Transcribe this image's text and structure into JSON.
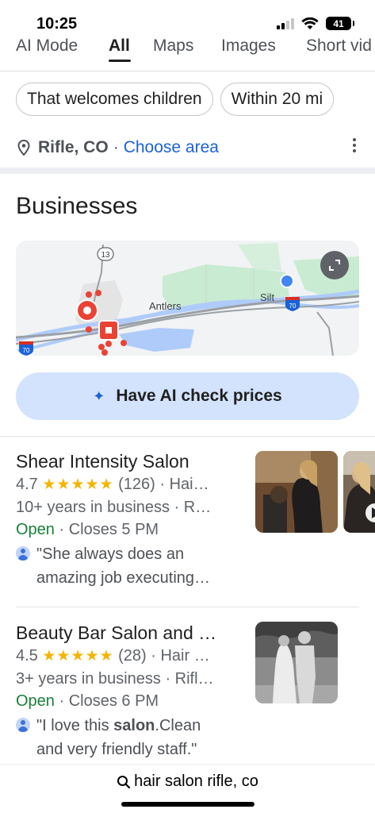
{
  "status_bar": {
    "time": "10:25",
    "battery": "41"
  },
  "tabs": [
    {
      "label": "AI Mode",
      "active": false
    },
    {
      "label": "All",
      "active": true
    },
    {
      "label": "Maps",
      "active": false
    },
    {
      "label": "Images",
      "active": false
    },
    {
      "label": "Short vid",
      "active": false
    }
  ],
  "filters": [
    "That welcomes children",
    "Within 20 mi"
  ],
  "location": {
    "city": "Rifle, CO",
    "separator": "·",
    "choose_label": "Choose area"
  },
  "section_title": "Businesses",
  "map": {
    "labels": {
      "route_13": "13",
      "antlers": "Antlers",
      "silt": "Silt",
      "route_70a": "70",
      "route_70b": "70"
    }
  },
  "ai_button": {
    "label": "Have AI check prices",
    "icon": "sparkle-icon"
  },
  "businesses": [
    {
      "name": "Shear Intensity Salon",
      "rating": "4.7",
      "stars": "★★★★★",
      "reviews": "(126)",
      "category": "Hai…",
      "meta": "10+ years in business · R…",
      "open_status": "Open",
      "hours": "Closes 5 PM",
      "review_line1": "\"She always does an",
      "review_line2": "amazing job executing…"
    },
    {
      "name": "Beauty Bar Salon and …",
      "rating": "4.5",
      "stars": "★★★★★",
      "reviews": "(28)",
      "category": "Hair …",
      "meta": "3+ years in business · Rifl…",
      "open_status": "Open",
      "hours": "Closes 6 PM",
      "review_pre": "\"I love this ",
      "review_bold": "salon",
      "review_post": ".Clean",
      "review_line2": "and very friendly staff.\""
    }
  ],
  "bottom": {
    "query": "hair salon rifle, co"
  },
  "colors": {
    "accent": "#1a62d6",
    "open": "#188038",
    "star": "#f4b400",
    "ai_bg": "#d3e3fd"
  }
}
